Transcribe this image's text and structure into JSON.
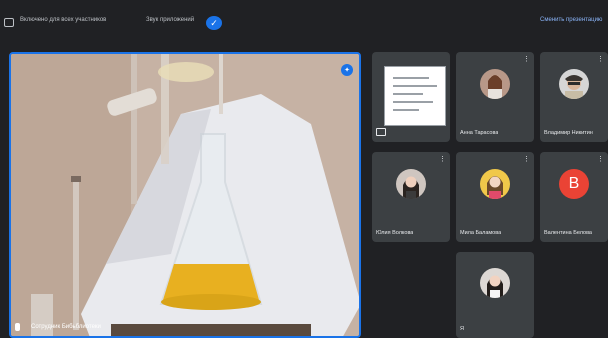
{
  "topbar": {
    "item1_label": "Включено для всех участников",
    "item2_label": "Звук приложений",
    "right_link": "Сменить презентацию"
  },
  "main_video": {
    "name": "Сотрудник Бибьблиотеки"
  },
  "participants": [
    {
      "name": "Анна Тарасова"
    },
    {
      "name": "Владимир Никитин"
    },
    {
      "name": "Юлия Волкова"
    },
    {
      "name": "Мила Баламова"
    },
    {
      "name": "Валентина Белова"
    },
    {
      "name": "Я"
    }
  ],
  "letter_avatar": {
    "letter": "В",
    "color": "#ea4335"
  },
  "icons": {
    "pin": "pin-icon",
    "more": "more-vert-icon",
    "mic": "mic-icon"
  }
}
